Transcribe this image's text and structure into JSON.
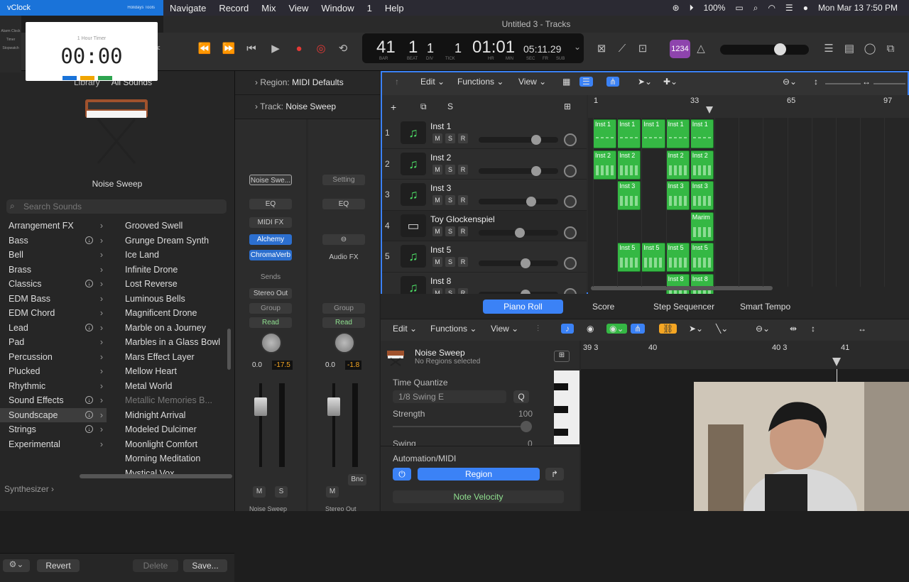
{
  "menubar": {
    "app": "vClock",
    "tab_extra": "Holidays  Tools",
    "items": [
      "Navigate",
      "Record",
      "Mix",
      "View",
      "Window",
      "1",
      "Help"
    ],
    "battery": "100%",
    "datetime": "Mon Mar 13  7:50 PM"
  },
  "window": {
    "title": "Untitled 3 - Tracks"
  },
  "vclock": {
    "title": "1 Hour Timer",
    "time": "00:00",
    "side": [
      "Alarm Clock",
      "Timer",
      "Stopwatch"
    ]
  },
  "lcd": {
    "bar": "41",
    "beat": "1",
    "div": "1",
    "tick": "1",
    "bar_lbl": "BAR",
    "beat_lbl": "BEAT",
    "div_lbl": "DIV",
    "tick_lbl": "TICK",
    "time": "01:01",
    "hr": "HR",
    "min": "MIN",
    "sec": "SEC",
    "timecode": "05:11.29",
    "fr": "FR",
    "sub": "SUB",
    "count_in": "1234"
  },
  "library": {
    "title": "Library",
    "filter": "All Sounds",
    "patch": "Noise Sweep",
    "search_placeholder": "Search Sounds",
    "categories": [
      {
        "label": "Arrangement FX",
        "dl": false
      },
      {
        "label": "Bass",
        "dl": true
      },
      {
        "label": "Bell",
        "dl": false
      },
      {
        "label": "Brass",
        "dl": false
      },
      {
        "label": "Classics",
        "dl": true
      },
      {
        "label": "EDM Bass",
        "dl": false
      },
      {
        "label": "EDM Chord",
        "dl": false
      },
      {
        "label": "Lead",
        "dl": true
      },
      {
        "label": "Pad",
        "dl": false
      },
      {
        "label": "Percussion",
        "dl": false
      },
      {
        "label": "Plucked",
        "dl": false
      },
      {
        "label": "Rhythmic",
        "dl": false
      },
      {
        "label": "Sound Effects",
        "dl": true
      },
      {
        "label": "Soundscape",
        "dl": true
      },
      {
        "label": "Strings",
        "dl": true
      },
      {
        "label": "Experimental",
        "dl": false
      }
    ],
    "sounds": [
      "Grooved Swell",
      "Grunge Dream Synth",
      "Ice Land",
      "Infinite Drone",
      "Lost Reverse",
      "Luminous Bells",
      "Magnificent Drone",
      "Marble on a Journey",
      "Marbles in a Glass Bowl",
      "Mars Effect Layer",
      "Mellow Heart",
      "Metal World",
      "Metallic Memories B...",
      "Midnight Arrival",
      "Modeled Dulcimer",
      "Moonlight Comfort",
      "Morning Meditation",
      "Mystical Vox"
    ],
    "footer": "Synthesizer",
    "revert": "Revert",
    "delete": "Delete",
    "save": "Save..."
  },
  "inspector": {
    "region_lbl": "Region:",
    "region": "MIDI Defaults",
    "track_lbl": "Track:",
    "track": "Noise Sweep",
    "strip1": {
      "setting": "Noise Swe...",
      "eq": "EQ",
      "midifx": "MIDI FX",
      "inst": "Alchemy",
      "fx": "ChromaVerb",
      "sends": "Sends",
      "out": "Stereo Out",
      "group": "Group",
      "auto": "Read",
      "vol": "0.0",
      "peak": "-17.5",
      "m": "M",
      "s": "S",
      "name": "Noise Sweep"
    },
    "strip2": {
      "setting": "Setting",
      "eq": "EQ",
      "audiofx": "Audio FX",
      "group": "Group",
      "auto": "Read",
      "vol": "0.0",
      "peak": "-1.8",
      "m": "M",
      "bnc": "Bnc",
      "name": "Stereo Out"
    }
  },
  "tracks_tb": {
    "edit": "Edit",
    "functions": "Functions",
    "view": "View",
    "s": "S"
  },
  "ruler": [
    "1",
    "33",
    "65",
    "97"
  ],
  "tracks": [
    {
      "n": "1",
      "name": "Inst 1",
      "vol": 0.75
    },
    {
      "n": "2",
      "name": "Inst 2",
      "vol": 0.75
    },
    {
      "n": "3",
      "name": "Inst 3",
      "vol": 0.68
    },
    {
      "n": "4",
      "name": "Toy Glockenspiel",
      "vol": 0.52
    },
    {
      "n": "5",
      "name": "Inst 5",
      "vol": 0.6
    },
    {
      "n": "",
      "name": "Inst 8",
      "vol": 0.6
    }
  ],
  "msr": [
    "M",
    "S",
    "R"
  ],
  "regions": [
    {
      "label": "Inst 1",
      "row": 0,
      "col": 0
    },
    {
      "label": "Inst 1",
      "row": 0,
      "col": 1
    },
    {
      "label": "Inst 1",
      "row": 0,
      "col": 2
    },
    {
      "label": "Inst 1",
      "row": 0,
      "col": 3
    },
    {
      "label": "Inst 1",
      "row": 0,
      "col": 4
    },
    {
      "label": "Inst 2",
      "row": 1,
      "col": 0
    },
    {
      "label": "Inst 2",
      "row": 1,
      "col": 1
    },
    {
      "label": "Inst 2",
      "row": 1,
      "col": 3
    },
    {
      "label": "Inst 2",
      "row": 1,
      "col": 4
    },
    {
      "label": "Inst 3",
      "row": 2,
      "col": 1
    },
    {
      "label": "Inst 3",
      "row": 2,
      "col": 3
    },
    {
      "label": "Inst 3",
      "row": 2,
      "col": 4
    },
    {
      "label": "Marim",
      "row": 3,
      "col": 4
    },
    {
      "label": "Inst 5",
      "row": 4,
      "col": 1
    },
    {
      "label": "Inst 5",
      "row": 4,
      "col": 2
    },
    {
      "label": "Inst 5",
      "row": 4,
      "col": 3
    },
    {
      "label": "Inst 5",
      "row": 4,
      "col": 4
    },
    {
      "label": "Inst 8",
      "row": 5,
      "col": 3
    },
    {
      "label": "Inst 8",
      "row": 5,
      "col": 4
    }
  ],
  "bottom_tabs": [
    "Piano Roll",
    "Score",
    "Step Sequencer",
    "Smart Tempo"
  ],
  "pianoroll": {
    "edit": "Edit",
    "functions": "Functions",
    "view": "View",
    "region_name": "Noise Sweep",
    "region_sub": "No Regions selected",
    "tq_lbl": "Time Quantize",
    "tq": "1/8 Swing E",
    "q": "Q",
    "strength_lbl": "Strength",
    "strength": "100",
    "swing_lbl": "Swing",
    "swing": "0",
    "auto_lbl": "Automation/MIDI",
    "region_btn": "Region",
    "velocity": "Note Velocity",
    "ruler": [
      "39 3",
      "40",
      "40 3",
      "41"
    ]
  }
}
